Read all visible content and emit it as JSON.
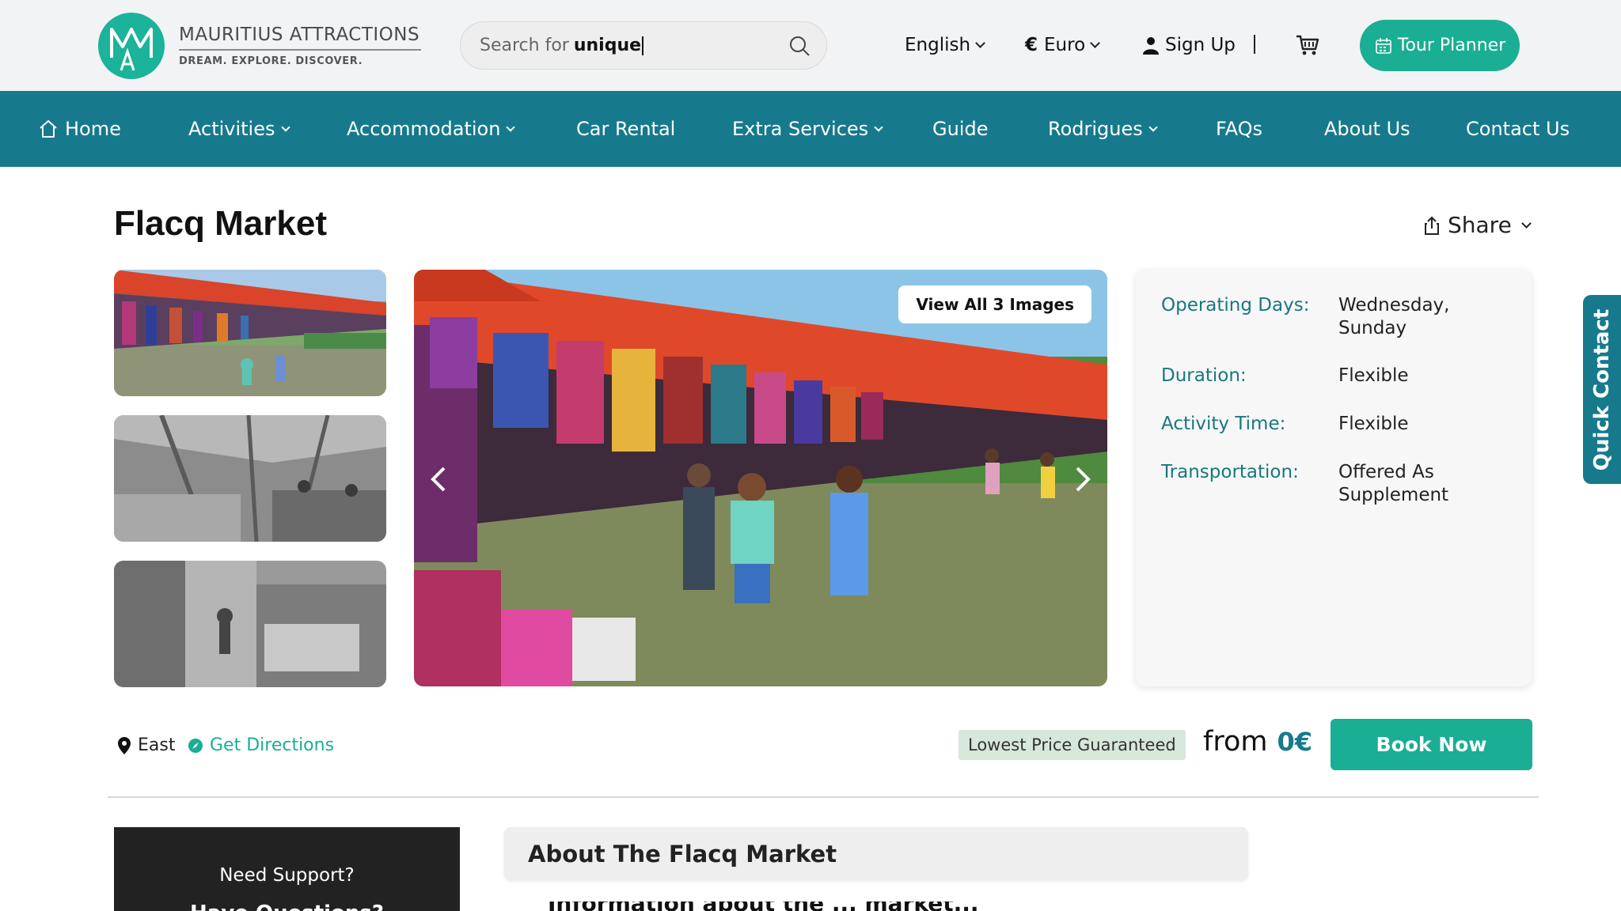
{
  "header": {
    "brand_name": "MAURITIUS ATTRACTIONS",
    "brand_tagline": "DREAM.  EXPLORE.  DISCOVER.",
    "search": {
      "placeholder": "Search for",
      "typed": "unique"
    },
    "language": "English",
    "currency": "Euro",
    "signup": "Sign Up",
    "tour_planner": "Tour Planner",
    "accent_color": "#1aae94"
  },
  "nav": {
    "color": "#167a8c",
    "items": [
      {
        "label": "Home",
        "icon": "home-icon"
      },
      {
        "label": "Activities",
        "dropdown": true
      },
      {
        "label": "Accommodation",
        "dropdown": true
      },
      {
        "label": "Car Rental"
      },
      {
        "label": "Extra Services",
        "dropdown": true
      },
      {
        "label": "Guide"
      },
      {
        "label": "Rodrigues",
        "dropdown": true
      },
      {
        "label": "FAQs"
      },
      {
        "label": "About Us"
      },
      {
        "label": "Contact Us"
      }
    ]
  },
  "page": {
    "title": "Flacq Market",
    "share": "Share"
  },
  "gallery": {
    "view_all": "View All 3 Images",
    "images": [
      "market-stalls-color",
      "market-hall-grayscale",
      "market-aisle-grayscale"
    ]
  },
  "info": {
    "rows": [
      {
        "label": "Operating Days:",
        "value": "Wednesday, Sunday"
      },
      {
        "label": "Duration:",
        "value": "Flexible"
      },
      {
        "label": "Activity Time:",
        "value": "Flexible"
      },
      {
        "label": "Transportation:",
        "value": "Offered As Supplement"
      }
    ]
  },
  "quick_contact": "Quick Contact",
  "booking": {
    "location": "East",
    "directions": "Get Directions",
    "badge": "Lowest Price Guaranteed",
    "from_label": "from",
    "price": "0€",
    "book_now": "Book Now"
  },
  "support": {
    "title": "Need Support?",
    "subtitle": "Have Questions?"
  },
  "about": {
    "heading": "About The Flacq Market",
    "first_line": "Information about the ... market..."
  }
}
